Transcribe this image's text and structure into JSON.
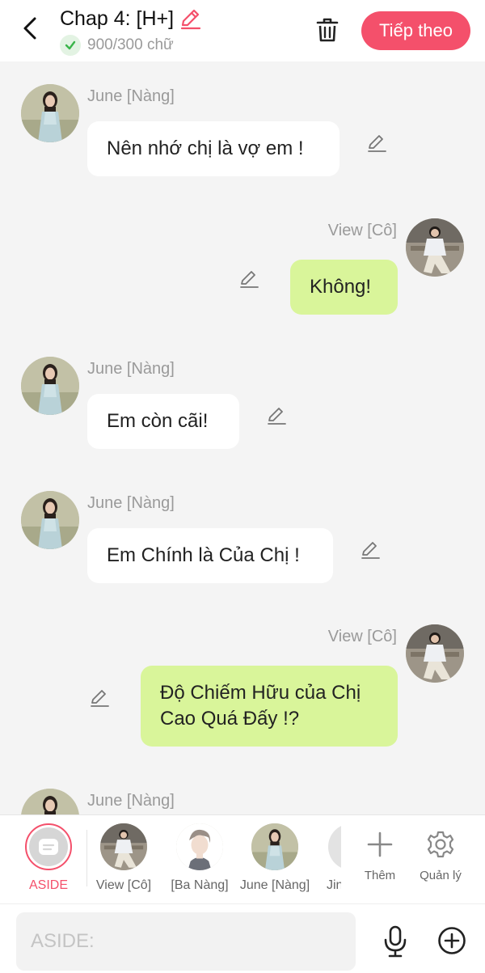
{
  "header": {
    "title": "Chap 4: [H+]",
    "word_count": "900/300 chữ",
    "next_label": "Tiếp theo",
    "icons": [
      "back-arrow-icon",
      "pencil-icon",
      "check-icon",
      "trash-icon"
    ]
  },
  "messages": [
    {
      "sender": "June [Nàng]",
      "text": "Nên nhớ chị là vợ em !",
      "side": "left"
    },
    {
      "sender": "View [Cô]",
      "text": "Không!",
      "side": "right"
    },
    {
      "sender": "June [Nàng]",
      "text": "Em còn cãi!",
      "side": "left"
    },
    {
      "sender": "June [Nàng]",
      "text": "Em Chính là Của Chị !",
      "side": "left"
    },
    {
      "sender": "View [Cô]",
      "text": "Độ Chiếm Hữu của Chị Cao Quá Đấy !?",
      "side": "right"
    },
    {
      "sender": "June [Nàng]",
      "text": "",
      "side": "left"
    }
  ],
  "characters": [
    {
      "label": "ASIDE",
      "selected": true
    },
    {
      "label": "View [Cô]"
    },
    {
      "label": "[Ba Nàng]"
    },
    {
      "label": "June [Nàng]"
    },
    {
      "label": "Jin"
    }
  ],
  "tools": [
    {
      "label": "Thêm",
      "icon": "plus-icon"
    },
    {
      "label": "Quản lý",
      "icon": "gear-icon"
    }
  ],
  "input": {
    "placeholder": "ASIDE:"
  },
  "colors": {
    "accent": "#f4506b",
    "bubble_right": "#d9f59a",
    "bubble_left": "#ffffff",
    "background": "#f4f4f4"
  }
}
